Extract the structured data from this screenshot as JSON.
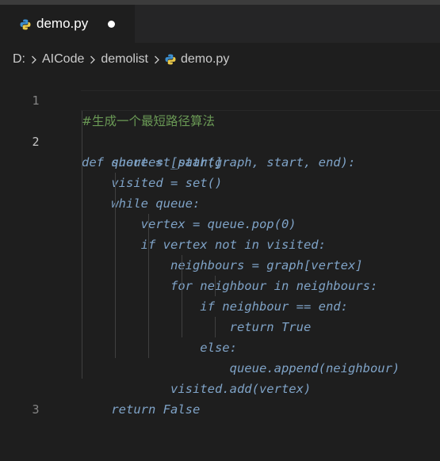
{
  "tab": {
    "label": "demo.py",
    "icon": "python-file-icon",
    "modified": true
  },
  "breadcrumb": {
    "items": [
      "D:",
      "AICode",
      "demolist",
      "demo.py"
    ],
    "separator_icon": "chevron-right-icon"
  },
  "colors": {
    "background": "#1e1e1e",
    "comment": "#6a9955",
    "code": "#7fa3c7",
    "line_number": "#858585"
  },
  "editor": {
    "lines": [
      {
        "number": "1",
        "text": "#生成一个最短路径算法"
      },
      {
        "number": "2",
        "text": "def shortest_path(graph, start, end):"
      },
      {
        "number": "",
        "text": "    queue = [start]"
      },
      {
        "number": "",
        "text": "    visited = set()"
      },
      {
        "number": "",
        "text": "    while queue:"
      },
      {
        "number": "",
        "text": "        vertex = queue.pop(0)"
      },
      {
        "number": "",
        "text": "        if vertex not in visited:"
      },
      {
        "number": "",
        "text": "            neighbours = graph[vertex]"
      },
      {
        "number": "",
        "text": "            for neighbour in neighbours:"
      },
      {
        "number": "",
        "text": "                if neighbour == end:"
      },
      {
        "number": "",
        "text": "                    return True"
      },
      {
        "number": "",
        "text": "                else:"
      },
      {
        "number": "",
        "text": "                    queue.append(neighbour)"
      },
      {
        "number": "",
        "text": "            visited.add(vertex)"
      },
      {
        "number": "",
        "text": "    return False"
      },
      {
        "number": "3",
        "text": ""
      }
    ]
  }
}
